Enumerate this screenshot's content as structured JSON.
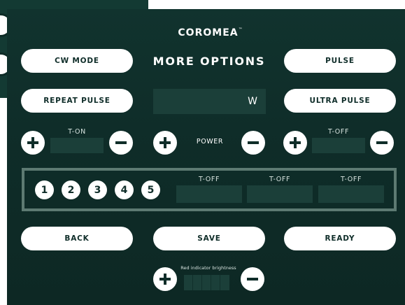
{
  "brand": {
    "name": "COROMEA",
    "trademark": "™"
  },
  "title": "MORE OPTIONS",
  "buttons": {
    "cw_mode": "CW MODE",
    "pulse": "PULSE",
    "repeat_pulse": "REPEAT PULSE",
    "ultra_pulse": "ULTRA PULSE",
    "back": "BACK",
    "save": "SAVE",
    "ready": "READY"
  },
  "power": {
    "label": "POWER",
    "unit": "W",
    "value": ""
  },
  "t_on": {
    "label": "T-ON",
    "value": ""
  },
  "t_off": {
    "label": "T-OFF",
    "value": ""
  },
  "pulse_group": {
    "numbers": [
      "1",
      "2",
      "3",
      "4",
      "5"
    ],
    "fields": [
      {
        "label": "T-OFF",
        "value": ""
      },
      {
        "label": "T-OFF",
        "value": ""
      },
      {
        "label": "T-OFF",
        "value": ""
      }
    ]
  },
  "brightness": {
    "label": "Red indicator brightness",
    "segments": 5,
    "level": 0
  },
  "colors": {
    "background": "#0f2d29",
    "field": "#1b3f39",
    "accent": "#ffffff",
    "border": "#5d7a72"
  }
}
